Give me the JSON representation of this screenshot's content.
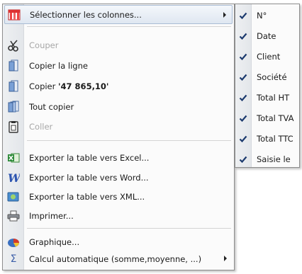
{
  "menu": {
    "select_columns": "Sélectionner les colonnes...",
    "cut": "Couper",
    "copy_line": "Copier la ligne",
    "copy_value_prefix": "Copier ",
    "copy_value": "'47 865,10'",
    "copy_all": "Tout copier",
    "paste": "Coller",
    "export_excel": "Exporter la table vers Excel...",
    "export_word": "Exporter la table vers Word...",
    "export_xml": "Exporter la table vers XML...",
    "print": "Imprimer...",
    "chart": "Graphique...",
    "auto_calc": "Calcul automatique (somme,moyenne, ...)"
  },
  "columns": [
    {
      "label": "N°",
      "checked": true
    },
    {
      "label": "Date",
      "checked": true
    },
    {
      "label": "Client",
      "checked": true
    },
    {
      "label": "Société",
      "checked": true
    },
    {
      "label": "Total HT",
      "checked": true
    },
    {
      "label": "Total TVA",
      "checked": true
    },
    {
      "label": "Total TTC",
      "checked": true
    },
    {
      "label": "Saisie le",
      "checked": true
    }
  ],
  "icons": {
    "select_columns": "columns-table-icon",
    "cut": "scissors-icon",
    "copy_line": "copy-page-icon",
    "copy_value": "copy-page-icon",
    "copy_all": "copy-pages-icon",
    "paste": "clipboard-icon",
    "export_excel": "excel-icon",
    "export_word": "word-icon",
    "export_xml": "xml-icon",
    "print": "printer-icon",
    "chart": "pie-chart-icon",
    "auto_calc": "sigma-icon"
  },
  "colors": {
    "checkmark": "#1c3a6e",
    "highlight_border": "#a9bcd4",
    "disabled_text": "#a7a7a7"
  }
}
